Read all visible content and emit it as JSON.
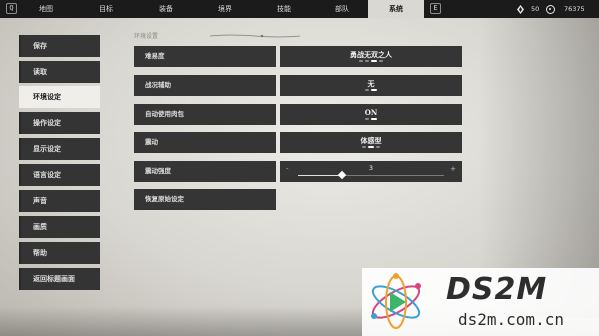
{
  "topbar": {
    "left_key": "Q",
    "right_key": "E",
    "tabs": [
      {
        "label": "地图"
      },
      {
        "label": "目标"
      },
      {
        "label": "装备"
      },
      {
        "label": "境界"
      },
      {
        "label": "技能"
      },
      {
        "label": "部队"
      },
      {
        "label": "系统",
        "active": true
      }
    ],
    "resources": [
      {
        "icon": "diamond-icon",
        "value": "50"
      },
      {
        "icon": "coin-icon",
        "value": "76375"
      }
    ]
  },
  "menu": {
    "items": [
      {
        "label": "保存"
      },
      {
        "label": "读取"
      },
      {
        "label": "环境设定",
        "active": true
      },
      {
        "label": "操作设定"
      },
      {
        "label": "显示设定"
      },
      {
        "label": "语言设定"
      },
      {
        "label": "声音"
      },
      {
        "label": "画质"
      },
      {
        "label": "帮助"
      },
      {
        "label": "返回标题画面"
      }
    ]
  },
  "section": {
    "title": "环境设置"
  },
  "settings": [
    {
      "label": "难易度",
      "value": "勇战无双之人",
      "options": 4,
      "selected": 3
    },
    {
      "label": "战况辅助",
      "value": "无",
      "options": 2,
      "selected": 2
    },
    {
      "label": "自动使用肉包",
      "value": "ON",
      "options": 2,
      "selected": 2
    },
    {
      "label": "震动",
      "value": "体感型",
      "options": 3,
      "selected": 2
    }
  ],
  "vibration_intensity": {
    "label": "震动强度",
    "value": "3",
    "minus": "-",
    "plus": "+",
    "fraction": 0.3
  },
  "reset": {
    "label": "恢复原始设定"
  },
  "watermark": {
    "title": "DS2M",
    "subtitle": "ds2m.com.cn"
  }
}
